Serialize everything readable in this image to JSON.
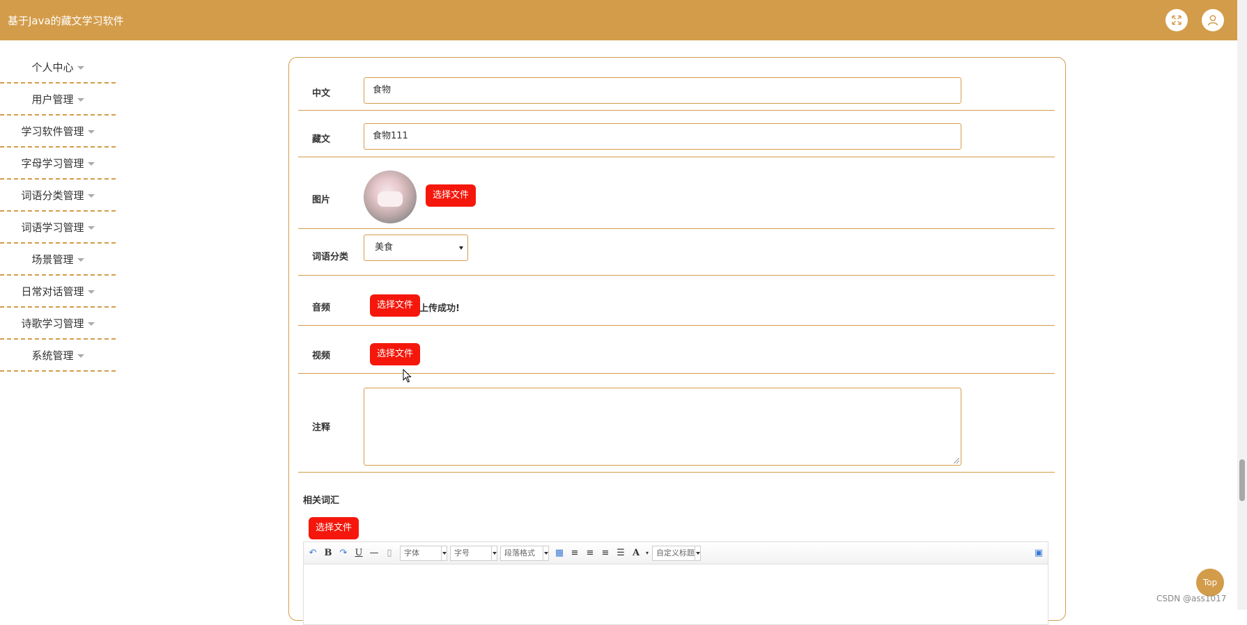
{
  "app": {
    "title": "基于Java的藏文学习软件"
  },
  "header": {
    "fullscreen_icon": "fullscreen-icon",
    "user_icon": "user-icon"
  },
  "sidebar": {
    "items": [
      {
        "label": "个人中心"
      },
      {
        "label": "用户管理"
      },
      {
        "label": "学习软件管理"
      },
      {
        "label": "字母学习管理"
      },
      {
        "label": "词语分类管理"
      },
      {
        "label": "词语学习管理"
      },
      {
        "label": "场景管理"
      },
      {
        "label": "日常对话管理"
      },
      {
        "label": "诗歌学习管理"
      },
      {
        "label": "系统管理"
      }
    ]
  },
  "form": {
    "chinese": {
      "label": "中文",
      "value": "食物"
    },
    "tibetan": {
      "label": "藏文",
      "value": "食物111"
    },
    "image": {
      "label": "图片",
      "button": "选择文件"
    },
    "category": {
      "label": "词语分类",
      "value": "美食"
    },
    "audio": {
      "label": "音频",
      "button": "选择文件",
      "status": "上传成功!"
    },
    "video": {
      "label": "视频",
      "button": "选择文件"
    },
    "notes": {
      "label": "注释",
      "value": ""
    },
    "related": {
      "label": "相关词汇",
      "button": "选择文件"
    }
  },
  "editor": {
    "font_family": "字体",
    "font_size": "字号",
    "paragraph": "段落格式",
    "custom_title": "自定义标题"
  },
  "footer": {
    "top_label": "Top",
    "watermark": "CSDN @ass1017"
  },
  "colors": {
    "brand": "#d39c4a",
    "button": "#f5170b"
  }
}
